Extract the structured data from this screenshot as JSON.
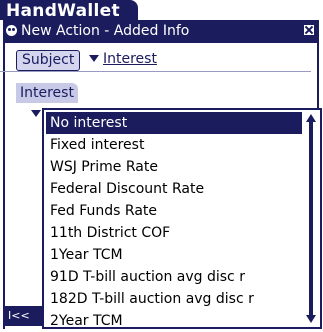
{
  "app": {
    "title": "HandWallet"
  },
  "dialog": {
    "title": "New Action - Added Info"
  },
  "subject": {
    "button_label": "Subject",
    "selected_value": "Interest"
  },
  "section": {
    "label": "Interest"
  },
  "bottom_button": {
    "label": "I<<"
  },
  "popup_list": {
    "items": [
      "No interest",
      "Fixed interest",
      "WSJ Prime Rate",
      "Federal Discount Rate",
      "Fed Funds Rate",
      "11th District COF",
      "1Year TCM",
      "91D T-bill auction avg disc r",
      "182D T-bill auction avg disc r",
      "2Year TCM"
    ],
    "selected_index": 0
  },
  "colors": {
    "accent": "#1b1c5e",
    "selection_bg": "#1b1c5e",
    "section_label_bg": "#c8c9e6",
    "subject_button_bg": "#d5d6ee"
  }
}
